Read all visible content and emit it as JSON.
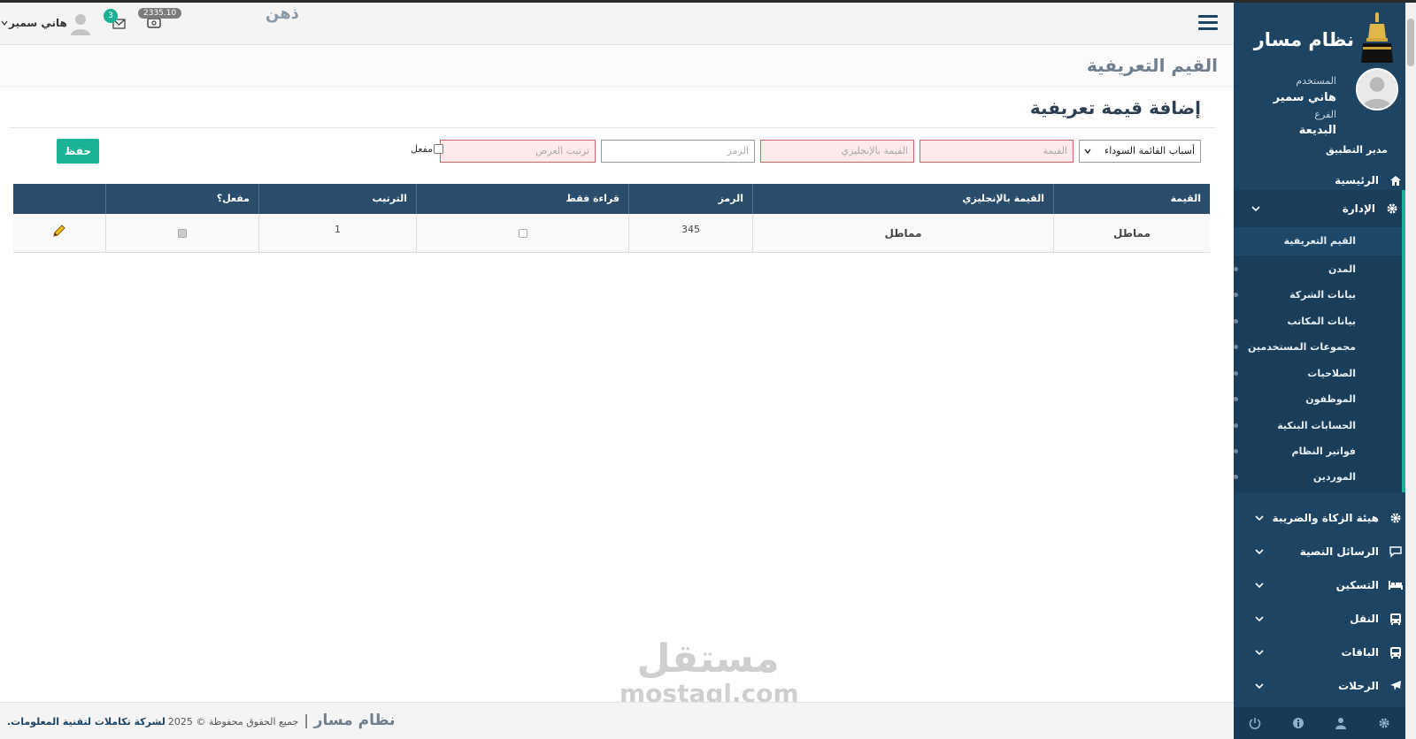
{
  "app": {
    "name": "نظام مسار"
  },
  "topbar": {
    "brand_word": "ذهن",
    "balance": "2335.10",
    "mail_count": "3",
    "user_name": "هاني سمير"
  },
  "sidebar": {
    "user_label": "المستخدم",
    "user_value": "هاني سمير",
    "branch_label": "الفرع",
    "branch_value": "البديعة",
    "role": "مدير التطبيق",
    "home": "الرئيسية",
    "admin": "الإدارة",
    "admin_items": [
      "القيم التعريفية",
      "المدن",
      "بيانات الشركة",
      "بيانات المكاتب",
      "مجموعات المستخدمين",
      "الصلاحيات",
      "الموظفون",
      "الحسابات البنكية",
      "فواتير النظام",
      "الموردين"
    ],
    "groups": [
      "هيئة الزكاة والضريبة",
      "الرسائل النصية",
      "التسكين",
      "النقل",
      "الباقات",
      "الرحلات"
    ],
    "footer_icons": [
      "gear-icon",
      "user-icon",
      "info-icon",
      "power-icon"
    ]
  },
  "page": {
    "title": "القيم التعريفية",
    "card_title": "إضافة قيمة تعريفية"
  },
  "form": {
    "list_selected": "أسباب القائمة السوداء",
    "value_placeholder": "القيمة",
    "english_placeholder": "القيمة بالإنجليزي",
    "code_placeholder": "الرمز",
    "order_placeholder": "ترتيب العرض",
    "active_label": "مفعل",
    "save_label": "حفظ"
  },
  "table": {
    "headers": [
      "القيمة",
      "القيمة بالإنجليزي",
      "الرمز",
      "قراءة فقط",
      "الترتيب",
      "مفعل؟",
      ""
    ],
    "rows": [
      {
        "value": "مماطل",
        "english": "مماطل",
        "code": "345",
        "readonly": false,
        "order": "1",
        "active": true
      }
    ]
  },
  "footer": {
    "brand": "نظام مسار",
    "separator": "|",
    "copyright": "جميع الحقوق محفوظة © 2025",
    "company": "لشركة تكاملات لتقنية المعلومات."
  },
  "watermark": {
    "arabic": "مستقل",
    "latin": "mostaql.com"
  },
  "colors": {
    "sidebar": "#1d4463",
    "accent": "#18b394",
    "table_header": "#2a4d6c"
  }
}
